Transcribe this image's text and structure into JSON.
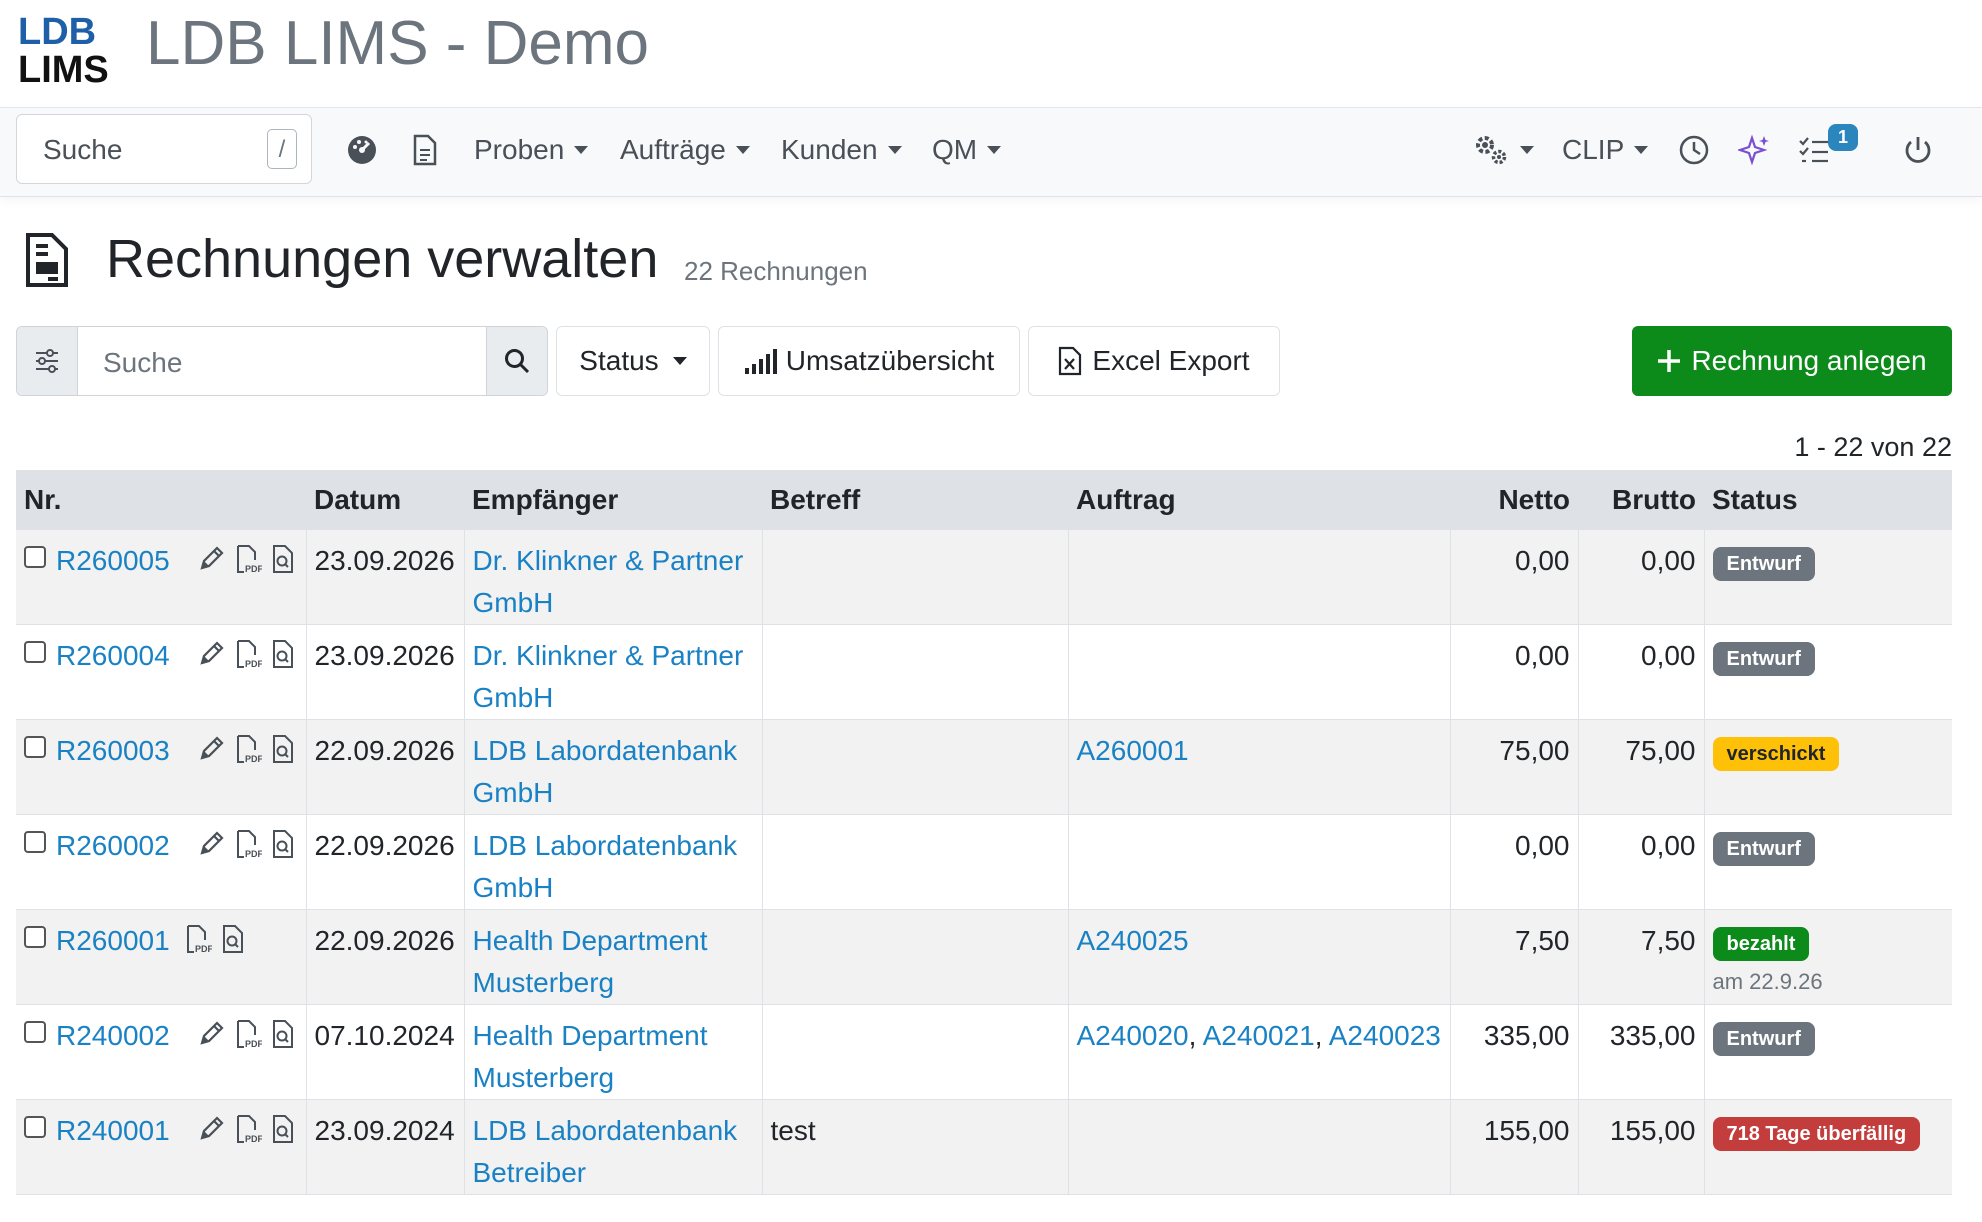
{
  "app": {
    "logo_text_top": "LDB",
    "logo_text_bottom": "LIMS",
    "title": "LDB LIMS - Demo"
  },
  "navbar": {
    "search_placeholder": "Suche",
    "search_shortcut": "/",
    "menus": [
      {
        "label": "Proben"
      },
      {
        "label": "Aufträge"
      },
      {
        "label": "Kunden"
      },
      {
        "label": "QM"
      }
    ],
    "clip_label": "CLIP",
    "tasks_count": "1",
    "icons": [
      "dashboard-icon",
      "document-icon",
      "settings-gears-icon",
      "clock-icon",
      "sparkles-icon",
      "checklist-icon",
      "power-icon"
    ]
  },
  "page": {
    "title": "Rechnungen verwalten",
    "count": "22 Rechnungen"
  },
  "toolbar": {
    "search_placeholder": "Suche",
    "status_label": "Status",
    "revenue_label": "Umsatzübersicht",
    "excel_label": "Excel Export",
    "create_label": "Rechnung anlegen"
  },
  "pager": "1 - 22 von 22",
  "table": {
    "headers": {
      "nr": "Nr.",
      "datum": "Datum",
      "empfaenger": "Empfänger",
      "betreff": "Betreff",
      "auftrag": "Auftrag",
      "netto": "Netto",
      "brutto": "Brutto",
      "status": "Status"
    },
    "rows": [
      {
        "nr": "R260005",
        "editable": true,
        "datum": "23.09.2026",
        "empfaenger_1": "Dr. Klinkner & Partner",
        "empfaenger_2": "GmbH",
        "betreff": "",
        "auftrag": [],
        "netto": "0,00",
        "brutto": "0,00",
        "status": "Entwurf",
        "status_color": "#6c757d"
      },
      {
        "nr": "R260004",
        "editable": true,
        "datum": "23.09.2026",
        "empfaenger_1": "Dr. Klinkner & Partner",
        "empfaenger_2": "GmbH",
        "betreff": "",
        "auftrag": [],
        "netto": "0,00",
        "brutto": "0,00",
        "status": "Entwurf",
        "status_color": "#6c757d"
      },
      {
        "nr": "R260003",
        "editable": true,
        "datum": "22.09.2026",
        "empfaenger_1": "LDB Labordatenbank",
        "empfaenger_2": "GmbH",
        "betreff": "",
        "auftrag": [
          "A260001"
        ],
        "netto": "75,00",
        "brutto": "75,00",
        "status": "verschickt",
        "status_color": "#ffc107"
      },
      {
        "nr": "R260002",
        "editable": true,
        "datum": "22.09.2026",
        "empfaenger_1": "LDB Labordatenbank",
        "empfaenger_2": "GmbH",
        "betreff": "",
        "auftrag": [],
        "netto": "0,00",
        "brutto": "0,00",
        "status": "Entwurf",
        "status_color": "#6c757d"
      },
      {
        "nr": "R260001",
        "editable": false,
        "datum": "22.09.2026",
        "empfaenger_1": "Health Department",
        "empfaenger_2": "Musterberg",
        "betreff": "",
        "auftrag": [
          "A240025"
        ],
        "netto": "7,50",
        "brutto": "7,50",
        "status": "bezahlt",
        "status_color": "#0c8a1a",
        "status_note": "am 22.9.26"
      },
      {
        "nr": "R240002",
        "editable": true,
        "datum": "07.10.2024",
        "empfaenger_1": "Health Department",
        "empfaenger_2": "Musterberg",
        "betreff": "",
        "auftrag": [
          "A240020",
          "A240021",
          "A240023"
        ],
        "netto": "335,00",
        "brutto": "335,00",
        "status": "Entwurf",
        "status_color": "#6c757d"
      },
      {
        "nr": "R240001",
        "editable": true,
        "datum": "23.09.2024",
        "empfaenger_1": "LDB Labordatenbank",
        "empfaenger_2": "Betreiber",
        "betreff": "test",
        "auftrag": [],
        "netto": "155,00",
        "brutto": "155,00",
        "status": "718 Tage überfällig",
        "status_color": "#c43d3d"
      }
    ]
  }
}
